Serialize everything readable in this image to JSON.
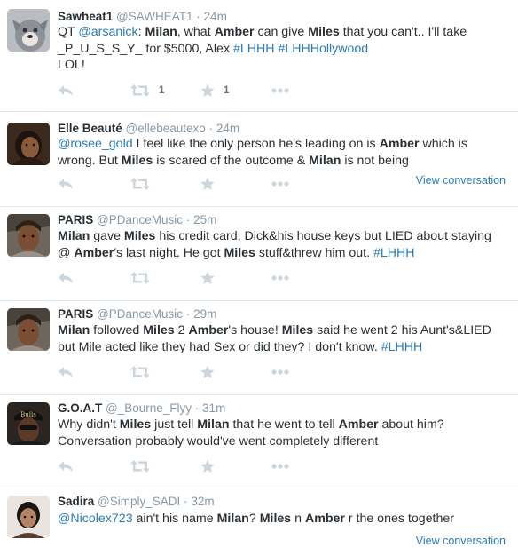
{
  "tweets": [
    {
      "fullname": "Sawheat1",
      "handle": "@SAWHEAT1",
      "time": "24m",
      "avatar": "dog-avatar",
      "segments": [
        {
          "t": "QT "
        },
        {
          "t": "@arsanick",
          "s": "link"
        },
        {
          "t": ": "
        },
        {
          "t": "Milan",
          "s": "bold"
        },
        {
          "t": ", what "
        },
        {
          "t": "Amber",
          "s": "bold"
        },
        {
          "t": " can give "
        },
        {
          "t": "Miles",
          "s": "bold"
        },
        {
          "t": " that you can't.. I'll take _P_U_S_S_Y_ for $5000, Alex "
        },
        {
          "t": "#LHHH",
          "s": "link"
        },
        {
          "t": " "
        },
        {
          "t": "#LHHHollywood",
          "s": "link"
        },
        {
          "t": "\nLOL!"
        }
      ],
      "retweet_count": "1",
      "favorite_count": "1",
      "view_conversation": ""
    },
    {
      "fullname": "Elle Beauté",
      "handle": "@ellebeautexo",
      "time": "24m",
      "avatar": "woman-avatar",
      "segments": [
        {
          "t": "@rosee_gold",
          "s": "link"
        },
        {
          "t": " I feel like the only person he's leading on is "
        },
        {
          "t": "Amber",
          "s": "bold"
        },
        {
          "t": " which is wrong. But "
        },
        {
          "t": "Miles",
          "s": "bold"
        },
        {
          "t": " is scared of the outcome & "
        },
        {
          "t": "Milan",
          "s": "bold"
        },
        {
          "t": " is not being"
        }
      ],
      "retweet_count": "",
      "favorite_count": "",
      "view_conversation": "View conversation"
    },
    {
      "fullname": "PARIS",
      "handle": "@PDanceMusic",
      "time": "25m",
      "avatar": "paris-avatar",
      "segments": [
        {
          "t": "Milan",
          "s": "bold"
        },
        {
          "t": " gave "
        },
        {
          "t": "Miles",
          "s": "bold"
        },
        {
          "t": " his credit card, Dick&his house keys but LIED about staying @ "
        },
        {
          "t": "Amber",
          "s": "bold"
        },
        {
          "t": "'s last night. He got "
        },
        {
          "t": "Miles",
          "s": "bold"
        },
        {
          "t": " stuff&threw him out. "
        },
        {
          "t": "#LHHH",
          "s": "link"
        }
      ],
      "retweet_count": "",
      "favorite_count": "",
      "view_conversation": ""
    },
    {
      "fullname": "PARIS",
      "handle": "@PDanceMusic",
      "time": "29m",
      "avatar": "paris-avatar",
      "segments": [
        {
          "t": "Milan",
          "s": "bold"
        },
        {
          "t": " followed "
        },
        {
          "t": "Miles",
          "s": "bold"
        },
        {
          "t": " 2 "
        },
        {
          "t": "Amber",
          "s": "bold"
        },
        {
          "t": "'s house! "
        },
        {
          "t": "Miles",
          "s": "bold"
        },
        {
          "t": " said he went 2 his Aunt's&LIED but Mile acted like they had Sex or did they? I don't know. "
        },
        {
          "t": "#LHHH",
          "s": "link"
        }
      ],
      "retweet_count": "",
      "favorite_count": "",
      "view_conversation": ""
    },
    {
      "fullname": "G.O.A.T",
      "handle": "@_Bourne_Flyy",
      "time": "31m",
      "avatar": "goat-avatar",
      "segments": [
        {
          "t": "Why didn't "
        },
        {
          "t": "Miles",
          "s": "bold"
        },
        {
          "t": " just tell "
        },
        {
          "t": "Milan",
          "s": "bold"
        },
        {
          "t": " that he went to tell "
        },
        {
          "t": "Amber",
          "s": "bold"
        },
        {
          "t": " about him? Conversation probably would've went completely different"
        }
      ],
      "retweet_count": "",
      "favorite_count": "",
      "view_conversation": ""
    },
    {
      "fullname": "Sadira",
      "handle": "@Simply_SADI",
      "time": "32m",
      "avatar": "sadira-avatar",
      "segments": [
        {
          "t": "@Nicolex723",
          "s": "link"
        },
        {
          "t": " ain't his name "
        },
        {
          "t": "Milan",
          "s": "bold"
        },
        {
          "t": "? "
        },
        {
          "t": "Miles",
          "s": "bold"
        },
        {
          "t": " n "
        },
        {
          "t": "Amber",
          "s": "bold"
        },
        {
          "t": " r the ones together"
        }
      ],
      "retweet_count": "",
      "favorite_count": "",
      "view_conversation": "View conversation"
    }
  ],
  "actions": {
    "reply_icon": "reply-icon",
    "retweet_icon": "retweet-icon",
    "favorite_icon": "star-icon",
    "more_icon": "more-dots-icon"
  },
  "colors": {
    "link": "#2b7bb9",
    "meta": "#8899a6",
    "action_icon": "#ccd6dd",
    "divider": "#e1e8ed",
    "text": "#292f33"
  }
}
